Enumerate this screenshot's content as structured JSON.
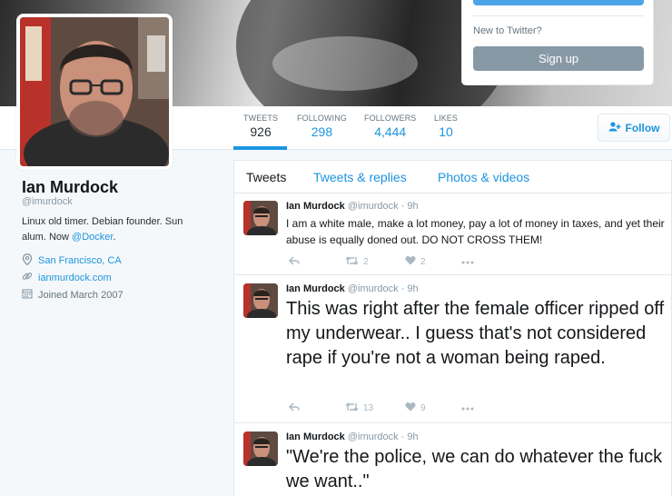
{
  "login": {
    "new_to_twitter": "New to Twitter?",
    "signup_label": "Sign up"
  },
  "stats": [
    {
      "label": "TWEETS",
      "value": "926"
    },
    {
      "label": "FOLLOWING",
      "value": "298"
    },
    {
      "label": "FOLLOWERS",
      "value": "4,444"
    },
    {
      "label": "LIKES",
      "value": "10"
    }
  ],
  "follow_label": "Follow",
  "profile": {
    "name": "Ian Murdock",
    "handle": "@imurdock",
    "bio_text": "Linux old timer. Debian founder. Sun alum. Now ",
    "bio_link": "@Docker",
    "bio_end": ".",
    "location": "San Francisco, CA",
    "website": "ianmurdock.com",
    "joined": "Joined March 2007"
  },
  "tabs": [
    {
      "label": "Tweets"
    },
    {
      "label": "Tweets & replies"
    },
    {
      "label": "Photos & videos"
    }
  ],
  "tweets": [
    {
      "name": "Ian Murdock",
      "handle": "@imurdock · 9h",
      "text": "I am a white male, make a lot money, pay a lot of money in taxes, and yet their abuse is equally doned out. DO NOT CROSS THEM!",
      "retweets": "2",
      "likes": "2"
    },
    {
      "name": "Ian Murdock",
      "handle": "@imurdock · 9h",
      "text": "This was right after the female officer ripped off my underwear.. I guess that's not considered rape if you're not a woman being raped.",
      "retweets": "13",
      "likes": "9"
    },
    {
      "name": "Ian Murdock",
      "handle": "@imurdock · 9h",
      "text": "\"We're the police, we can do whatever the fuck we want..\""
    }
  ],
  "colors": {
    "accent": "#1b95e0",
    "signup": "#8899a6"
  },
  "icons": [
    "map-pin-icon",
    "link-icon",
    "calendar-icon",
    "reply-icon",
    "retweet-icon",
    "heart-icon",
    "more-icon",
    "add-user-icon"
  ]
}
